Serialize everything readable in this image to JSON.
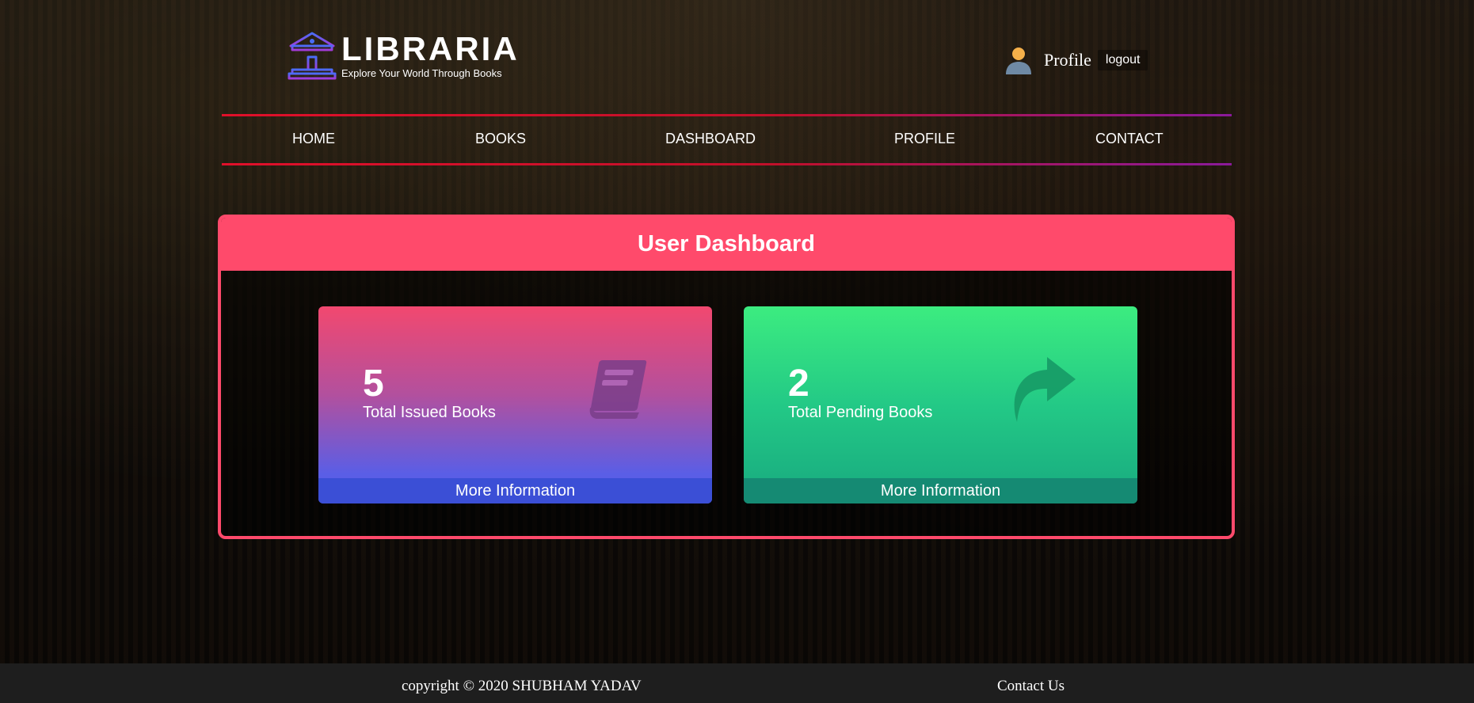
{
  "brand": {
    "title": "LIBRARIA",
    "tagline": "Explore Your World Through Books",
    "icon": "library-building-icon"
  },
  "user": {
    "icon": "user-avatar-icon",
    "profile_label": "Profile",
    "logout_label": "logout"
  },
  "nav": {
    "items": [
      {
        "label": "HOME"
      },
      {
        "label": "BOOKS"
      },
      {
        "label": "DASHBOARD"
      },
      {
        "label": "PROFILE"
      },
      {
        "label": "CONTACT"
      }
    ]
  },
  "dashboard": {
    "title": "User Dashboard",
    "accent": "#ff4a6b",
    "cards": [
      {
        "count": "5",
        "label": "Total Issued Books",
        "footer": "More Information",
        "icon": "book-icon"
      },
      {
        "count": "2",
        "label": "Total Pending Books",
        "footer": "More Information",
        "icon": "share-arrow-icon"
      }
    ]
  },
  "footer": {
    "copyright": "copyright © 2020 SHUBHAM YADAV",
    "contact": "Contact Us"
  }
}
